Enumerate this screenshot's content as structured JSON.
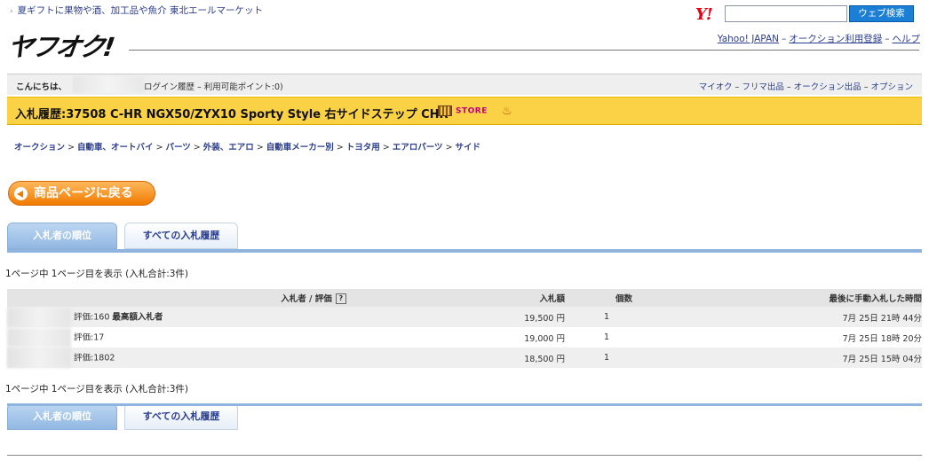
{
  "header": {
    "promo_arrow": "›",
    "promo_text": "夏ギフトに果物や酒、加工品や魚介 東北エールマーケット",
    "yahoo_logo": "Y!",
    "search_button": "ウェブ検索",
    "search_value": "",
    "auction_logo": "ヤフオク!",
    "links": [
      "Yahoo! JAPAN",
      "オークション利用登録",
      "ヘルプ"
    ],
    "link_sep": "–"
  },
  "user_bar": {
    "greeting": "こんにちは、",
    "login_history": "ログイン履歴 – 利用可能ポイント:0)",
    "links": [
      "マイオク",
      "フリマ出品",
      "オークション出品",
      "オプション"
    ],
    "link_sep": "–"
  },
  "title_bar": {
    "title": "入札履歴:37508 C-HR NGX50/ZYX10 Sporty Style 右サイドステップ CHR",
    "store_badge": "STORE",
    "bird_icon": "♨"
  },
  "breadcrumb": [
    "オークション",
    "自動車、オートバイ",
    "パーツ",
    "外装、エアロ",
    "自動車メーカー別",
    "トヨタ用",
    "エアロパーツ",
    "サイド"
  ],
  "breadcrumb_sep": ">",
  "back_button": "商品ページに戻る",
  "tabs": {
    "ranking": "入札者の順位",
    "all_history": "すべての入札履歴"
  },
  "page_info": "1ページ中 1ページ目を表示 (入札合計:3件)",
  "table": {
    "headers": {
      "bidder": "入札者 / 評価",
      "amount": "入札額",
      "count": "個数",
      "time": "最後に手動入札した時間"
    },
    "help_icon": "?",
    "rows": [
      {
        "rating": "評価:160",
        "badge": "最高額入札者",
        "amount": "19,500 円",
        "count": "1",
        "time": "7月 25日 21時 44分"
      },
      {
        "rating": "評価:17",
        "badge": "",
        "amount": "19,000 円",
        "count": "1",
        "time": "7月 25日 18時 20分"
      },
      {
        "rating": "評価:1802",
        "badge": "",
        "amount": "18,500 円",
        "count": "1",
        "time": "7月 25日 15時 04分"
      }
    ]
  },
  "colors": {
    "title_bar": "#fbd245",
    "tab_active": "#92b8e2",
    "back_button": "#f07a00",
    "link": "#2c3e8e"
  }
}
